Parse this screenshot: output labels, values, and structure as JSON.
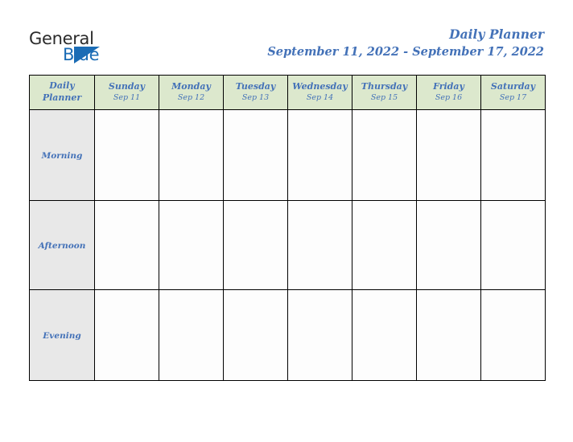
{
  "brand": {
    "logo_word_1": "General",
    "logo_word_2": "Blue",
    "logo_icon": "triangle-mark",
    "color_dark": "#2b2b2b",
    "color_blue": "#1b6cb5"
  },
  "header": {
    "title": "Daily Planner",
    "date_range": "September 11, 2022 - September 17, 2022",
    "accent_color": "#4472b8"
  },
  "table": {
    "corner_label_line1": "Daily",
    "corner_label_line2": "Planner",
    "header_bg": "#dce8cd",
    "row_label_bg": "#e8e8e8",
    "cell_bg": "#fdfdfd",
    "border_color": "#000000",
    "columns": [
      {
        "day": "Sunday",
        "date": "Sep 11"
      },
      {
        "day": "Monday",
        "date": "Sep 12"
      },
      {
        "day": "Tuesday",
        "date": "Sep 13"
      },
      {
        "day": "Wednesday",
        "date": "Sep 14"
      },
      {
        "day": "Thursday",
        "date": "Sep 15"
      },
      {
        "day": "Friday",
        "date": "Sep 16"
      },
      {
        "day": "Saturday",
        "date": "Sep 17"
      }
    ],
    "rows": [
      {
        "label": "Morning",
        "cells": [
          "",
          "",
          "",
          "",
          "",
          "",
          ""
        ]
      },
      {
        "label": "Afternoon",
        "cells": [
          "",
          "",
          "",
          "",
          "",
          "",
          ""
        ]
      },
      {
        "label": "Evening",
        "cells": [
          "",
          "",
          "",
          "",
          "",
          "",
          ""
        ]
      }
    ]
  }
}
